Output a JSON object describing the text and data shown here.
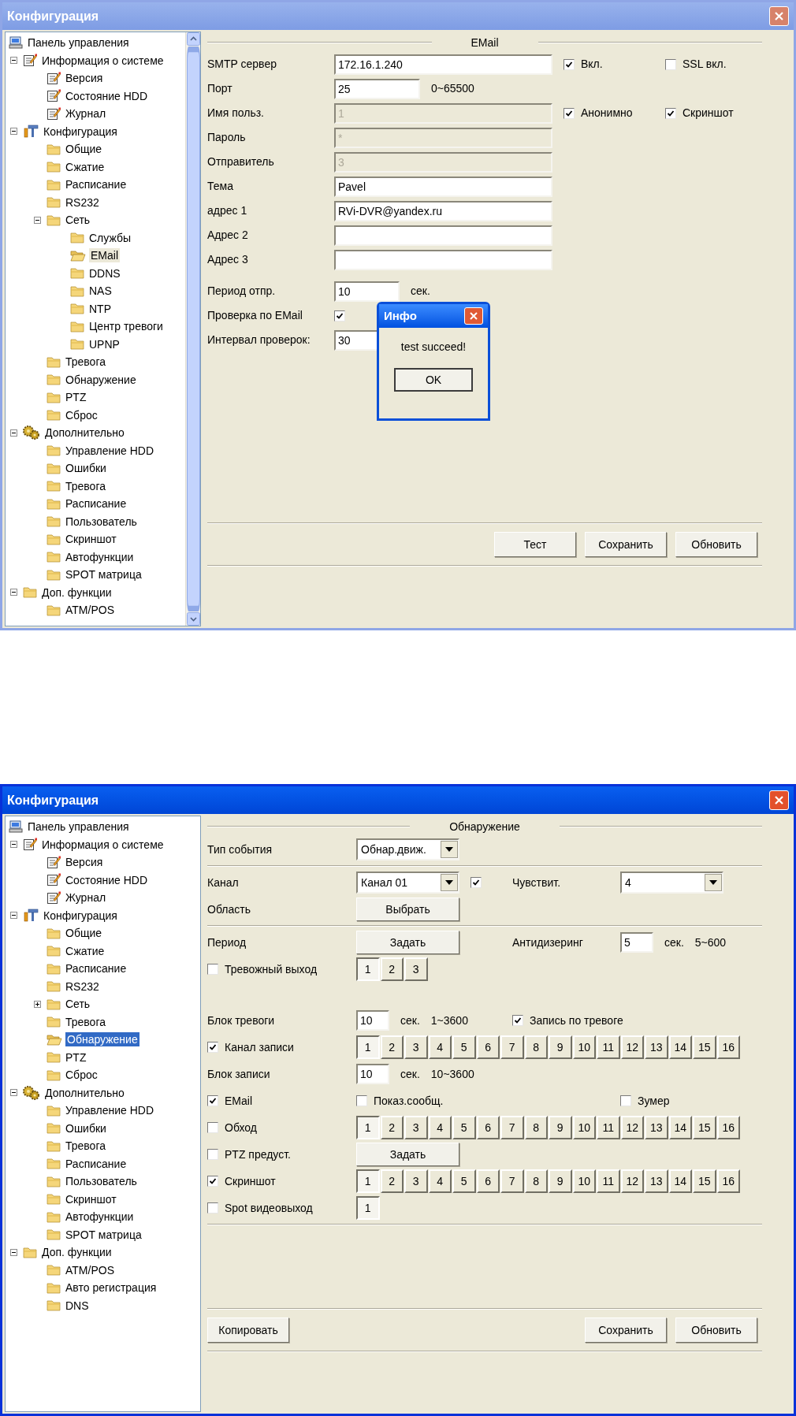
{
  "windows": [
    {
      "title": "Конфигурация",
      "active": false,
      "tree": {
        "focused": false,
        "scrollbar": true,
        "items": [
          {
            "label": "Панель управления",
            "kind": "computer",
            "selected": false
          },
          {
            "label": "Информация о системе",
            "kind": "notepad",
            "selected": false,
            "expanded": true,
            "children": [
              {
                "label": "Версия",
                "kind": "notepad",
                "selected": false
              },
              {
                "label": "Состояние HDD",
                "kind": "notepad",
                "selected": false
              },
              {
                "label": "Журнал",
                "kind": "notepad",
                "selected": false
              }
            ]
          },
          {
            "label": "Конфигурация",
            "kind": "tools",
            "selected": false,
            "expanded": true,
            "children": [
              {
                "label": "Общие",
                "kind": "folder",
                "selected": false
              },
              {
                "label": "Сжатие",
                "kind": "folder",
                "selected": false
              },
              {
                "label": "Расписание",
                "kind": "folder",
                "selected": false
              },
              {
                "label": "RS232",
                "kind": "folder",
                "selected": false
              },
              {
                "label": "Сеть",
                "kind": "folder",
                "selected": false,
                "expanded": true,
                "children": [
                  {
                    "label": "Службы",
                    "kind": "folder",
                    "selected": false
                  },
                  {
                    "label": "EMail",
                    "kind": "folder",
                    "selected": true
                  },
                  {
                    "label": "DDNS",
                    "kind": "folder",
                    "selected": false
                  },
                  {
                    "label": "NAS",
                    "kind": "folder",
                    "selected": false
                  },
                  {
                    "label": "NTP",
                    "kind": "folder",
                    "selected": false
                  },
                  {
                    "label": "Центр тревоги",
                    "kind": "folder",
                    "selected": false
                  },
                  {
                    "label": "UPNP",
                    "kind": "folder",
                    "selected": false
                  }
                ]
              },
              {
                "label": "Тревога",
                "kind": "folder",
                "selected": false
              },
              {
                "label": "Обнаружение",
                "kind": "folder",
                "selected": false
              },
              {
                "label": "PTZ",
                "kind": "folder",
                "selected": false
              },
              {
                "label": "Сброс",
                "kind": "folder",
                "selected": false
              }
            ]
          },
          {
            "label": "Дополнительно",
            "kind": "gears",
            "selected": false,
            "expanded": true,
            "children": [
              {
                "label": "Управление HDD",
                "kind": "folder",
                "selected": false
              },
              {
                "label": "Ошибки",
                "kind": "folder",
                "selected": false
              },
              {
                "label": "Тревога",
                "kind": "folder",
                "selected": false
              },
              {
                "label": "Расписание",
                "kind": "folder",
                "selected": false
              },
              {
                "label": "Пользователь",
                "kind": "folder",
                "selected": false
              },
              {
                "label": "Скриншот",
                "kind": "folder",
                "selected": false
              },
              {
                "label": "Автофункции",
                "kind": "folder",
                "selected": false
              },
              {
                "label": "SPOT матрица",
                "kind": "folder",
                "selected": false
              }
            ]
          },
          {
            "label": "Доп. функции",
            "kind": "folder",
            "selected": false,
            "expanded": true,
            "children": [
              {
                "label": "ATM/POS",
                "kind": "folder",
                "selected": false
              }
            ]
          }
        ]
      },
      "panel": {
        "kind": "email",
        "section_title": "EMail",
        "groups": [
          {
            "divider_after": false,
            "rows": [
              {
                "label": [
                  {
                    "kind": "text",
                    "text": "SMTP сервер"
                  }
                ],
                "main": [
                  {
                    "kind": "textfield",
                    "value": "172.16.1.240",
                    "disabled": false
                  }
                ],
                "side": [
                  {
                    "kind": "check",
                    "label": "Вкл.",
                    "checked": true
                  }
                ],
                "far": [
                  {
                    "kind": "check",
                    "label": "SSL вкл.",
                    "checked": false
                  }
                ]
              },
              {
                "label": [
                  {
                    "kind": "text",
                    "text": "Порт"
                  }
                ],
                "main": [
                  {
                    "kind": "numberfield",
                    "value": "25",
                    "disabled": false
                  },
                  {
                    "kind": "text",
                    "text": "0~65500"
                  }
                ]
              },
              {
                "label": [
                  {
                    "kind": "text",
                    "text": "Имя польз."
                  }
                ],
                "main": [
                  {
                    "kind": "textfield",
                    "value": "1",
                    "disabled": true
                  }
                ],
                "side": [
                  {
                    "kind": "check",
                    "label": "Анонимно",
                    "checked": true
                  }
                ],
                "far": [
                  {
                    "kind": "check",
                    "label": "Скриншот",
                    "checked": true
                  }
                ]
              },
              {
                "label": [
                  {
                    "kind": "text",
                    "text": "Пароль"
                  }
                ],
                "main": [
                  {
                    "kind": "textfield",
                    "value": "*",
                    "disabled": true
                  }
                ]
              },
              {
                "label": [
                  {
                    "kind": "text",
                    "text": "Отправитель"
                  }
                ],
                "main": [
                  {
                    "kind": "textfield",
                    "value": "3",
                    "disabled": true
                  }
                ]
              },
              {
                "label": [
                  {
                    "kind": "text",
                    "text": "Тема"
                  }
                ],
                "main": [
                  {
                    "kind": "textfield",
                    "value": "Pavel",
                    "disabled": false
                  }
                ]
              },
              {
                "label": [
                  {
                    "kind": "text",
                    "text": "адрес 1"
                  }
                ],
                "main": [
                  {
                    "kind": "textfield",
                    "value": "RVi-DVR@yandex.ru",
                    "disabled": false
                  }
                ]
              },
              {
                "label": [
                  {
                    "kind": "text",
                    "text": "Адрес 2"
                  }
                ],
                "main": [
                  {
                    "kind": "textfield",
                    "disabled": false
                  }
                ]
              },
              {
                "label": [
                  {
                    "kind": "text",
                    "text": "Адрес 3"
                  }
                ],
                "main": [
                  {
                    "kind": "textfield",
                    "disabled": false
                  }
                ]
              }
            ]
          },
          {
            "divider_after": false,
            "rows": [
              {
                "label": [
                  {
                    "kind": "text",
                    "text": "Период отпр."
                  }
                ],
                "main": [
                  {
                    "kind": "shortfield",
                    "value": "10",
                    "disabled": false
                  },
                  {
                    "kind": "text",
                    "text": "сек."
                  }
                ]
              },
              {
                "label": [
                  {
                    "kind": "text",
                    "text": "Проверка по EMail"
                  }
                ],
                "main": [
                  {
                    "kind": "check",
                    "checked": true
                  }
                ]
              },
              {
                "label": [
                  {
                    "kind": "text",
                    "text": "Интервал проверок:"
                  }
                ],
                "main": [
                  {
                    "kind": "shortfield",
                    "value": "30",
                    "disabled": false
                  }
                ]
              }
            ]
          }
        ],
        "buttons": [
          "Тест",
          "Сохранить",
          "Обновить"
        ],
        "dialog": {
          "title": "Инфо",
          "message": "test succeed!",
          "button": "OK"
        }
      }
    },
    {
      "title": "Конфигурация",
      "active": true,
      "tree": {
        "focused": true,
        "scrollbar": false,
        "items": [
          {
            "label": "Панель управления",
            "kind": "computer",
            "selected": false
          },
          {
            "label": "Информация о системе",
            "kind": "notepad",
            "selected": false,
            "expanded": true,
            "children": [
              {
                "label": "Версия",
                "kind": "notepad",
                "selected": false
              },
              {
                "label": "Состояние HDD",
                "kind": "notepad",
                "selected": false
              },
              {
                "label": "Журнал",
                "kind": "notepad",
                "selected": false
              }
            ]
          },
          {
            "label": "Конфигурация",
            "kind": "tools",
            "selected": false,
            "expanded": true,
            "children": [
              {
                "label": "Общие",
                "kind": "folder",
                "selected": false
              },
              {
                "label": "Сжатие",
                "kind": "folder",
                "selected": false
              },
              {
                "label": "Расписание",
                "kind": "folder",
                "selected": false
              },
              {
                "label": "RS232",
                "kind": "folder",
                "selected": false
              },
              {
                "label": "Сеть",
                "kind": "folder",
                "selected": false,
                "expanded": false
              },
              {
                "label": "Тревога",
                "kind": "folder",
                "selected": false
              },
              {
                "label": "Обнаружение",
                "kind": "folder",
                "selected": true
              },
              {
                "label": "PTZ",
                "kind": "folder",
                "selected": false
              },
              {
                "label": "Сброс",
                "kind": "folder",
                "selected": false
              }
            ]
          },
          {
            "label": "Дополнительно",
            "kind": "gears",
            "selected": false,
            "expanded": true,
            "children": [
              {
                "label": "Управление HDD",
                "kind": "folder",
                "selected": false
              },
              {
                "label": "Ошибки",
                "kind": "folder",
                "selected": false
              },
              {
                "label": "Тревога",
                "kind": "folder",
                "selected": false
              },
              {
                "label": "Расписание",
                "kind": "folder",
                "selected": false
              },
              {
                "label": "Пользователь",
                "kind": "folder",
                "selected": false
              },
              {
                "label": "Скриншот",
                "kind": "folder",
                "selected": false
              },
              {
                "label": "Автофункции",
                "kind": "folder",
                "selected": false
              },
              {
                "label": "SPOT матрица",
                "kind": "folder",
                "selected": false
              }
            ]
          },
          {
            "label": "Доп. функции",
            "kind": "folder",
            "selected": false,
            "expanded": true,
            "children": [
              {
                "label": "ATM/POS",
                "kind": "folder",
                "selected": false
              },
              {
                "label": "Авто регистрация",
                "kind": "folder",
                "selected": false
              },
              {
                "label": "DNS",
                "kind": "folder",
                "selected": false
              }
            ]
          }
        ]
      },
      "panel": {
        "kind": "detection",
        "section_title": "Обнаружение",
        "groups": [
          {
            "divider_after": true,
            "rows": [
              {
                "label": [
                  {
                    "kind": "text",
                    "text": "Тип события"
                  }
                ],
                "main": [
                  {
                    "kind": "select",
                    "value": "Обнар.движ."
                  }
                ]
              }
            ]
          },
          {
            "divider_after": true,
            "rows": [
              {
                "label": [
                  {
                    "kind": "text",
                    "text": "Канал"
                  }
                ],
                "main": [
                  {
                    "kind": "select",
                    "value": "Канал 01"
                  },
                  {
                    "kind": "check",
                    "checked": true
                  }
                ],
                "side": [
                  {
                    "kind": "text",
                    "text": "Чувствит."
                  }
                ],
                "far": [
                  {
                    "kind": "select",
                    "value": "4"
                  }
                ]
              },
              {
                "label": [
                  {
                    "kind": "text",
                    "text": "Область"
                  }
                ],
                "main": [
                  {
                    "kind": "button",
                    "label": "Выбрать"
                  }
                ]
              }
            ]
          },
          {
            "divider_after": false,
            "rows": [
              {
                "label": [
                  {
                    "kind": "text",
                    "text": "Период"
                  }
                ],
                "main": [
                  {
                    "kind": "button",
                    "label": "Задать"
                  }
                ],
                "side": [
                  {
                    "kind": "text",
                    "text": "Антидизеринг"
                  }
                ],
                "far": [
                  {
                    "kind": "tinyfield",
                    "value": "5",
                    "disabled": false
                  },
                  {
                    "kind": "text",
                    "text": "сек."
                  },
                  {
                    "kind": "text",
                    "text": "5~600"
                  }
                ]
              },
              {
                "label": [
                  {
                    "kind": "check",
                    "label": "Тревожный выход",
                    "checked": false
                  }
                ],
                "main": [
                  {
                    "kind": "toggles",
                    "items": [
                      {
                        "label": "1",
                        "selected": true
                      },
                      {
                        "label": "2",
                        "selected": false
                      },
                      {
                        "label": "3",
                        "selected": false
                      }
                    ]
                  }
                ]
              }
            ]
          },
          {
            "divider_after": true,
            "rows": [
              {
                "label": [
                  {
                    "kind": "text",
                    "text": "Блок тревоги"
                  }
                ],
                "main": [
                  {
                    "kind": "tinyfield",
                    "value": "10",
                    "disabled": false
                  },
                  {
                    "kind": "text",
                    "text": "сек."
                  },
                  {
                    "kind": "text",
                    "text": "1~3600"
                  }
                ],
                "side": [
                  {
                    "kind": "check",
                    "label": "Запись по тревоге",
                    "checked": true
                  }
                ]
              },
              {
                "label": [
                  {
                    "kind": "check",
                    "label": "Канал записи",
                    "checked": true
                  }
                ],
                "main": [
                  {
                    "kind": "toggles",
                    "items": [
                      {
                        "label": "1",
                        "selected": true
                      },
                      {
                        "label": "2",
                        "selected": false
                      },
                      {
                        "label": "3",
                        "selected": false
                      },
                      {
                        "label": "4",
                        "selected": false
                      },
                      {
                        "label": "5",
                        "selected": false
                      },
                      {
                        "label": "6",
                        "selected": false
                      },
                      {
                        "label": "7",
                        "selected": false
                      },
                      {
                        "label": "8",
                        "selected": false
                      },
                      {
                        "label": "9",
                        "selected": false
                      },
                      {
                        "label": "10",
                        "selected": false
                      },
                      {
                        "label": "11",
                        "selected": false
                      },
                      {
                        "label": "12",
                        "selected": false
                      },
                      {
                        "label": "13",
                        "selected": false
                      },
                      {
                        "label": "14",
                        "selected": false
                      },
                      {
                        "label": "15",
                        "selected": false
                      },
                      {
                        "label": "16",
                        "selected": false
                      }
                    ]
                  }
                ]
              },
              {
                "label": [
                  {
                    "kind": "text",
                    "text": "Блок записи"
                  }
                ],
                "main": [
                  {
                    "kind": "tinyfield",
                    "value": "10",
                    "disabled": false
                  },
                  {
                    "kind": "text",
                    "text": "сек."
                  },
                  {
                    "kind": "text",
                    "text": "10~3600"
                  }
                ]
              },
              {
                "label": [
                  {
                    "kind": "check",
                    "label": "EMail",
                    "checked": true
                  }
                ],
                "main": [
                  {
                    "kind": "check",
                    "label": "Показ.сообщ.",
                    "checked": false
                  }
                ],
                "far": [
                  {
                    "kind": "check",
                    "label": "Зумер",
                    "checked": false
                  }
                ]
              },
              {
                "label": [
                  {
                    "kind": "check",
                    "label": "Обход",
                    "checked": false
                  }
                ],
                "main": [
                  {
                    "kind": "toggles",
                    "items": [
                      {
                        "label": "1",
                        "selected": true
                      },
                      {
                        "label": "2",
                        "selected": false
                      },
                      {
                        "label": "3",
                        "selected": false
                      },
                      {
                        "label": "4",
                        "selected": false
                      },
                      {
                        "label": "5",
                        "selected": false
                      },
                      {
                        "label": "6",
                        "selected": false
                      },
                      {
                        "label": "7",
                        "selected": false
                      },
                      {
                        "label": "8",
                        "selected": false
                      },
                      {
                        "label": "9",
                        "selected": false
                      },
                      {
                        "label": "10",
                        "selected": false
                      },
                      {
                        "label": "11",
                        "selected": false
                      },
                      {
                        "label": "12",
                        "selected": false
                      },
                      {
                        "label": "13",
                        "selected": false
                      },
                      {
                        "label": "14",
                        "selected": false
                      },
                      {
                        "label": "15",
                        "selected": false
                      },
                      {
                        "label": "16",
                        "selected": false
                      }
                    ]
                  }
                ]
              },
              {
                "label": [
                  {
                    "kind": "check",
                    "label": "PTZ предуст.",
                    "checked": false
                  }
                ],
                "main": [
                  {
                    "kind": "button",
                    "label": "Задать"
                  }
                ]
              },
              {
                "label": [
                  {
                    "kind": "check",
                    "label": "Скриншот",
                    "checked": true
                  }
                ],
                "main": [
                  {
                    "kind": "toggles",
                    "items": [
                      {
                        "label": "1",
                        "selected": true
                      },
                      {
                        "label": "2",
                        "selected": false
                      },
                      {
                        "label": "3",
                        "selected": false
                      },
                      {
                        "label": "4",
                        "selected": false
                      },
                      {
                        "label": "5",
                        "selected": false
                      },
                      {
                        "label": "6",
                        "selected": false
                      },
                      {
                        "label": "7",
                        "selected": false
                      },
                      {
                        "label": "8",
                        "selected": false
                      },
                      {
                        "label": "9",
                        "selected": false
                      },
                      {
                        "label": "10",
                        "selected": false
                      },
                      {
                        "label": "11",
                        "selected": false
                      },
                      {
                        "label": "12",
                        "selected": false
                      },
                      {
                        "label": "13",
                        "selected": false
                      },
                      {
                        "label": "14",
                        "selected": false
                      },
                      {
                        "label": "15",
                        "selected": false
                      },
                      {
                        "label": "16",
                        "selected": false
                      }
                    ]
                  }
                ]
              },
              {
                "label": [
                  {
                    "kind": "check",
                    "label": "Spot видеовыход",
                    "checked": false
                  }
                ],
                "main": [
                  {
                    "kind": "toggles",
                    "items": [
                      {
                        "label": "1",
                        "selected": true
                      }
                    ]
                  }
                ]
              }
            ]
          }
        ],
        "buttons_left": [
          "Копировать"
        ],
        "buttons": [
          "Сохранить",
          "Обновить"
        ]
      }
    }
  ]
}
